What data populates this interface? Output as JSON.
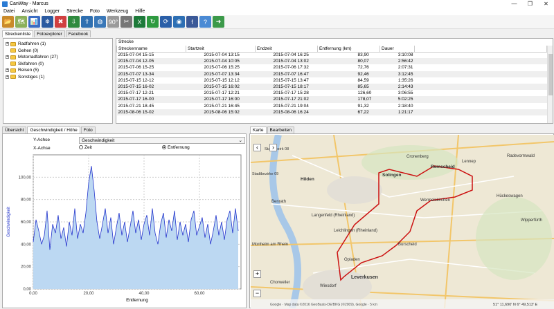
{
  "window": {
    "title": "CanWay - Marcus",
    "minimize": "—",
    "maximize": "❐",
    "close": "✕"
  },
  "menu": [
    "Datei",
    "Ansicht",
    "Logger",
    "Strecke",
    "Foto",
    "Werkzeug",
    "Hilfe"
  ],
  "toolbar_icons": [
    {
      "name": "open-icon",
      "color": "#c98a2a",
      "glyph": "📂"
    },
    {
      "name": "map-icon",
      "color": "#8bb05a",
      "glyph": "🗺"
    },
    {
      "name": "chart-icon",
      "color": "#3b6cc4",
      "glyph": "📊"
    },
    {
      "name": "gps-icon",
      "color": "#2a5aa0",
      "glyph": "⛯"
    },
    {
      "name": "delete-track-icon",
      "color": "#d04040",
      "glyph": "✖"
    },
    {
      "name": "import-icon",
      "color": "#2f8a3f",
      "glyph": "⇩"
    },
    {
      "name": "export-icon",
      "color": "#2f6fb0",
      "glyph": "⇧"
    },
    {
      "name": "globe-icon",
      "color": "#3a78b8",
      "glyph": "◍"
    },
    {
      "name": "rotate-90-icon",
      "color": "#9a9a9a",
      "glyph": "90°"
    },
    {
      "name": "tools-icon",
      "color": "#777777",
      "glyph": "✂"
    },
    {
      "name": "excel-icon",
      "color": "#1d7a3a",
      "glyph": "X"
    },
    {
      "name": "refresh-icon",
      "color": "#2e9a40",
      "glyph": "↻"
    },
    {
      "name": "sync-icon",
      "color": "#2a5fa8",
      "glyph": "⟳"
    },
    {
      "name": "earth-icon",
      "color": "#2d6fb4",
      "glyph": "◉"
    },
    {
      "name": "facebook-icon",
      "color": "#3b5998",
      "glyph": "f"
    },
    {
      "name": "help-icon",
      "color": "#4a8ad4",
      "glyph": "?"
    },
    {
      "name": "exit-icon",
      "color": "#3c9a4a",
      "glyph": "➜"
    }
  ],
  "top_tabs": [
    "Streckenliste",
    "Fotoexplorer",
    "Facebook"
  ],
  "tree": [
    {
      "label": "Radfahren (1)"
    },
    {
      "label": "Gehen (0)"
    },
    {
      "label": "Motorradfahren (27)"
    },
    {
      "label": "Skifahren (0)"
    },
    {
      "label": "Reisen (5)"
    },
    {
      "label": "Sonstiges (1)"
    }
  ],
  "strecke": {
    "label": "Strecke",
    "columns": [
      "Streckenname",
      "Startzeit",
      "Endzeit",
      "Entfernung (km)",
      "Dauer"
    ],
    "rows": [
      [
        "2015-07-04 15-15",
        "2015-07-04 13:15",
        "2015-07-04 16:25",
        "83,90",
        "3:10:08"
      ],
      [
        "2015-07-04 12-05",
        "2015-07-04 10:05",
        "2015-07-04 13:02",
        "80,07",
        "2:56:42"
      ],
      [
        "2015-07-06 15-25",
        "2015-07-06 15:25",
        "2015-07-06 17:32",
        "72,76",
        "2:07:31"
      ],
      [
        "2015-07-07 13-34",
        "2015-07-07 13:34",
        "2015-07-07 16:47",
        "92,46",
        "3:12:45"
      ],
      [
        "2015-07-15 12-12",
        "2015-07-15 12:12",
        "2015-07-15 13:47",
        "84,59",
        "1:35:26"
      ],
      [
        "2015-07-15 16-02",
        "2015-07-15 16:02",
        "2015-07-15 18:17",
        "85,65",
        "2:14:43"
      ],
      [
        "2015-07-17 12-21",
        "2015-07-17 12:21",
        "2015-07-17 15:28",
        "126,60",
        "3:06:55"
      ],
      [
        "2015-07-17 16-00",
        "2015-07-17 16:00",
        "2015-07-17 21:02",
        "178,07",
        "5:02:25"
      ],
      [
        "2015-07-21 18-45",
        "2015-07-21 16:45",
        "2015-07-21 19:04",
        "91,32",
        "2:18:40"
      ],
      [
        "2015-08-06 15-02",
        "2015-08-06 15:02",
        "2015-08-06 16:24",
        "67,22",
        "1:21:17"
      ]
    ]
  },
  "bottom_left_tabs": [
    "Übersicht",
    "Geschwindigkeit / Höhe",
    "Foto"
  ],
  "chart_controls": {
    "y_label": "Y-Achse",
    "y_value": "Geschwindigkeit",
    "x_label": "X-Achse",
    "x_option_time": "Zeit",
    "x_option_distance": "Entfernung"
  },
  "chart_data": {
    "type": "area",
    "title": "",
    "xlabel": "Entfernung",
    "ylabel": "Geschwindigkeit",
    "xlim": [
      0,
      75
    ],
    "ylim": [
      0,
      120
    ],
    "x_ticks": [
      "0,00",
      "20,00",
      "40,00",
      "60,00"
    ],
    "y_ticks": [
      "0,00",
      "20,00",
      "40,00",
      "60,00",
      "80,00",
      "100,00"
    ],
    "fill_color": "#bcd8f2",
    "line_color": "#2233cc",
    "x": [
      0,
      1,
      2,
      3,
      4,
      5,
      6,
      7,
      8,
      9,
      10,
      11,
      12,
      13,
      14,
      15,
      16,
      17,
      18,
      19,
      20,
      21,
      22,
      23,
      24,
      25,
      26,
      27,
      28,
      29,
      30,
      31,
      32,
      33,
      34,
      35,
      36,
      37,
      38,
      39,
      40,
      41,
      42,
      43,
      44,
      45,
      46,
      47,
      48,
      49,
      50,
      51,
      52,
      53,
      54,
      55,
      56,
      57,
      58,
      59,
      60,
      61,
      62,
      63,
      64,
      65,
      66,
      67,
      68,
      69,
      70,
      71,
      72,
      73,
      74
    ],
    "y": [
      42,
      62,
      52,
      40,
      48,
      70,
      35,
      58,
      50,
      66,
      45,
      55,
      38,
      60,
      48,
      72,
      45,
      58,
      50,
      68,
      95,
      110,
      88,
      60,
      45,
      58,
      72,
      50,
      64,
      40,
      55,
      68,
      48,
      60,
      42,
      56,
      70,
      50,
      62,
      44,
      58,
      66,
      48,
      72,
      50,
      40,
      58,
      68,
      46,
      62,
      52,
      70,
      44,
      60,
      48,
      58,
      42,
      62,
      70,
      48,
      56,
      64,
      46,
      58,
      40,
      52,
      66,
      48,
      60,
      44,
      62,
      70,
      50,
      72,
      52
    ]
  },
  "bottom_right_tabs": [
    "Karte",
    "Bearbeiten"
  ],
  "map": {
    "labels": [
      "Cronenberg",
      "Remscheid",
      "Lennep",
      "Solingen",
      "Hilden",
      "Langenfeld (Rheinland)",
      "Wermelskirchen",
      "Leichlingen (Rheinland)",
      "Burscheid",
      "Leverkusen",
      "Opladen",
      "Monheim am Rhein",
      "Chorweiler",
      "Wiesdorf",
      "Benrath",
      "Radevormwald",
      "Hückeswagen",
      "Wipperfürth",
      "Stadtbezirke 09",
      "Stadtbezirk 08"
    ],
    "attribution": "Google · Map data ©2016 GeoBasis-DE/BKG (©2009), Google · 5 km",
    "coords": "51° 11,690' N 6° 49,513' E",
    "zoom_in": "+",
    "zoom_out": "−"
  }
}
